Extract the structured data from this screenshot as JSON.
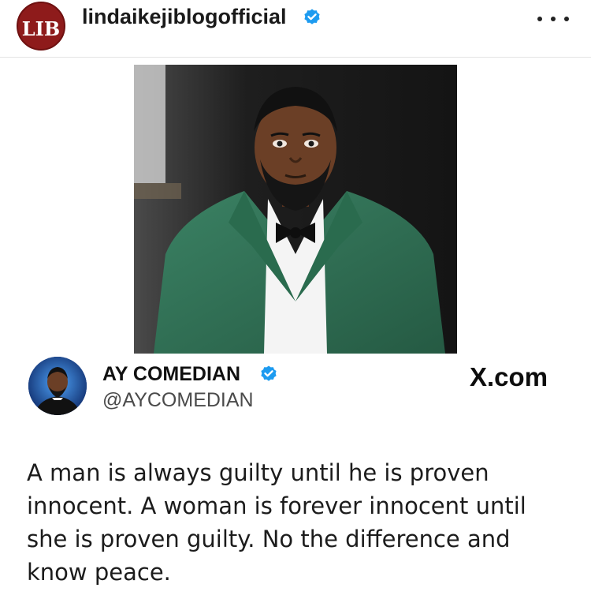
{
  "header": {
    "logo_text": "LIB",
    "username": "lindaikejiblogofficial",
    "verified_icon": "verified-badge-icon",
    "more_icon": "more-options-icon"
  },
  "post": {
    "photo_icon": "portrait-photo",
    "tweet": {
      "display_name": "AY COMEDIAN",
      "handle": "@AYCOMEDIAN",
      "source": "X.com",
      "text": "A man is always guilty until he is proven innocent. A woman is forever innocent until she is proven guilty. No the difference and know peace."
    }
  },
  "colors": {
    "brand_red": "#8e1b1b",
    "verified_blue": "#1d9bf0",
    "suit_green": "#2f6e52"
  }
}
